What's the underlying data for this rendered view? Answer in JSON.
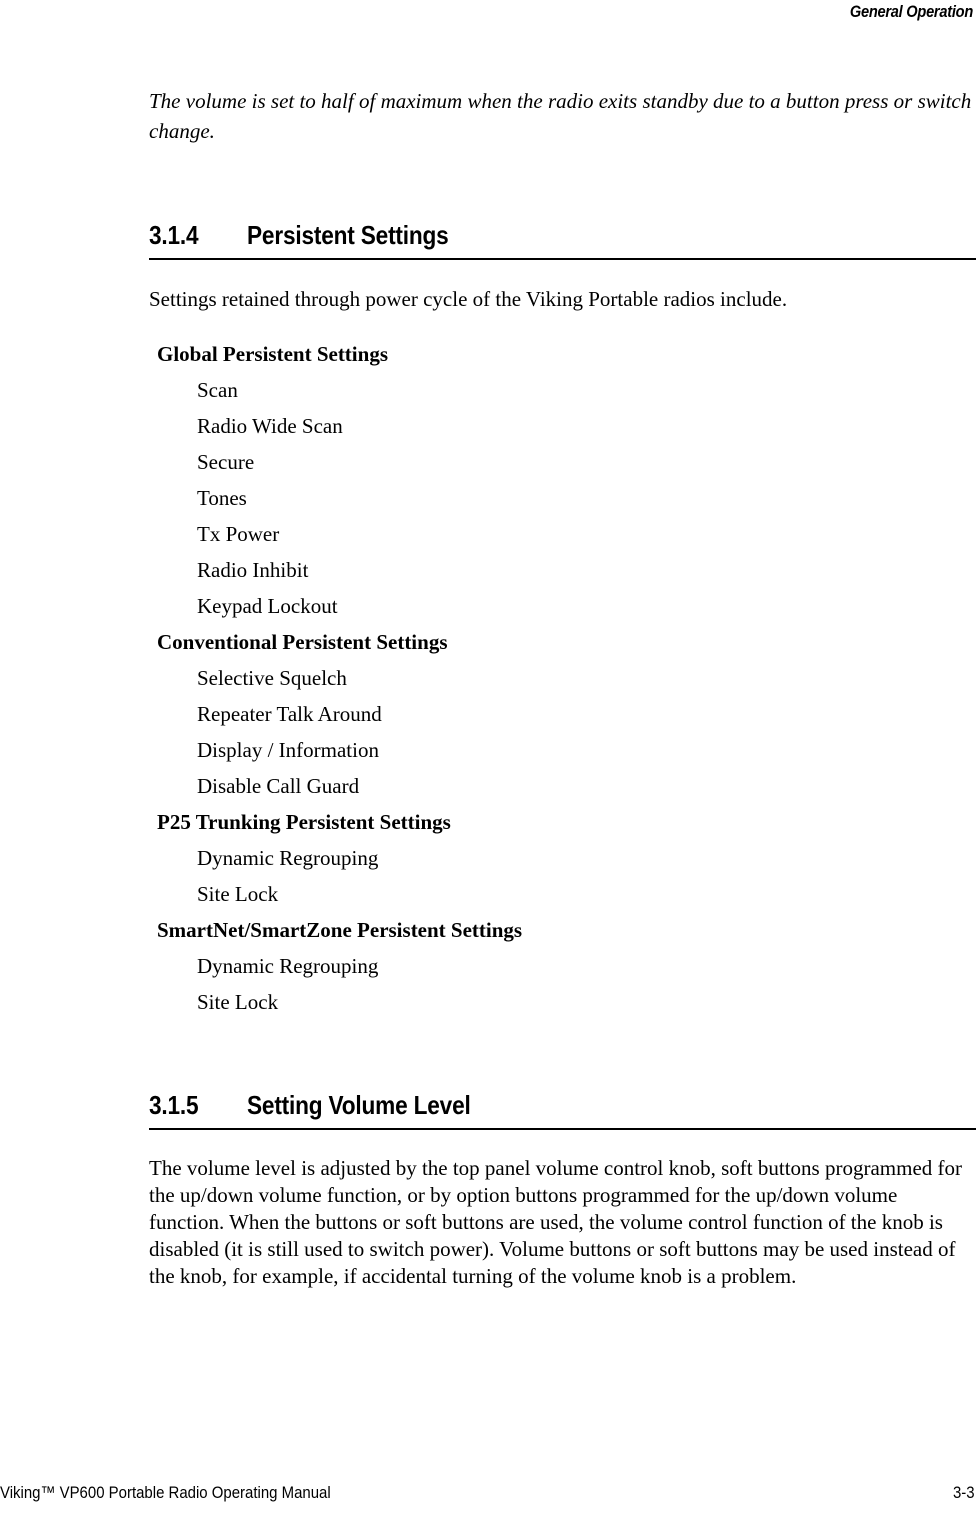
{
  "header": {
    "running_head": "General Operation"
  },
  "intro_note": "The volume is set to half of maximum when the radio exits standby due to a button press or switch change.",
  "sections": [
    {
      "number": "3.1.4",
      "title": "Persistent Settings",
      "lead_paragraph": "Settings retained through power cycle of the Viking Portable radios include."
    },
    {
      "number": "3.1.5",
      "title": "Setting Volume Level",
      "body": "The volume level is adjusted by the top panel volume control knob, soft buttons programmed for the up/down volume function, or by option buttons programmed for the up/down volume function. When the buttons or soft buttons are used, the volume control function of the knob is disabled (it is still used to switch power). Volume buttons or soft buttons may be used instead of the knob, for example, if accidental turning of the volume knob is a problem."
    }
  ],
  "settings_groups": [
    {
      "title": "Global Persistent Settings",
      "items": [
        "Scan",
        "Radio Wide Scan",
        "Secure",
        "Tones",
        "Tx Power",
        "Radio Inhibit",
        "Keypad Lockout"
      ]
    },
    {
      "title": "Conventional Persistent Settings",
      "items": [
        "Selective Squelch",
        "Repeater Talk Around",
        "Display / Information",
        "Disable Call Guard"
      ]
    },
    {
      "title": "P25 Trunking Persistent Settings",
      "items": [
        "Dynamic Regrouping",
        "Site Lock"
      ]
    },
    {
      "title": "SmartNet/SmartZone Persistent Settings",
      "items": [
        "Dynamic Regrouping",
        "Site Lock"
      ]
    }
  ],
  "footer": {
    "left": "Viking™ VP600 Portable Radio Operating Manual",
    "page_number": "3-3"
  }
}
